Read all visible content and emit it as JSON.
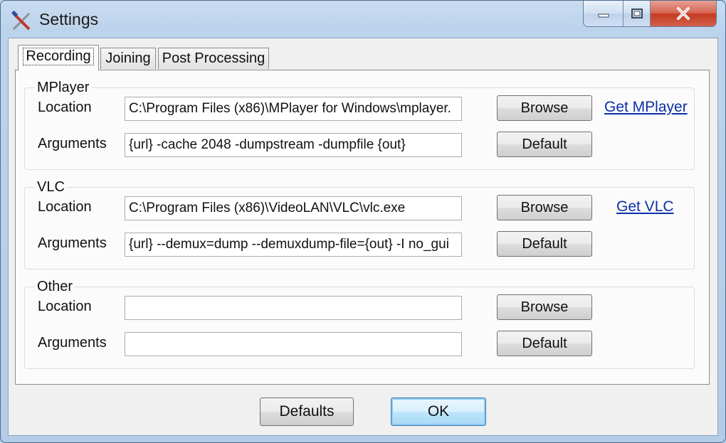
{
  "window": {
    "title": "Settings",
    "icon": "tools-icon"
  },
  "tabs": [
    {
      "label": "Recording",
      "active": true
    },
    {
      "label": "Joining",
      "active": false
    },
    {
      "label": "Post Processing",
      "active": false
    }
  ],
  "groups": {
    "mplayer": {
      "title": "MPlayer",
      "location_label": "Location",
      "location_value": "C:\\Program Files (x86)\\MPlayer for Windows\\mplayer.",
      "arguments_label": "Arguments",
      "arguments_value": "{url} -cache 2048 -dumpstream -dumpfile {out}",
      "browse_label": "Browse",
      "default_label": "Default",
      "link_label": "Get MPlayer"
    },
    "vlc": {
      "title": "VLC",
      "location_label": "Location",
      "location_value": "C:\\Program Files (x86)\\VideoLAN\\VLC\\vlc.exe",
      "arguments_label": "Arguments",
      "arguments_value": "{url} --demux=dump --demuxdump-file={out} -I no_gui",
      "browse_label": "Browse",
      "default_label": "Default",
      "link_label": "Get VLC"
    },
    "other": {
      "title": "Other",
      "location_label": "Location",
      "location_value": "",
      "arguments_label": "Arguments",
      "arguments_value": "",
      "browse_label": "Browse",
      "default_label": "Default"
    }
  },
  "footer": {
    "defaults_label": "Defaults",
    "ok_label": "OK"
  },
  "colors": {
    "link": "#0a2fa8",
    "close_button": "#c4391f",
    "frame": "#b9d1ea"
  }
}
